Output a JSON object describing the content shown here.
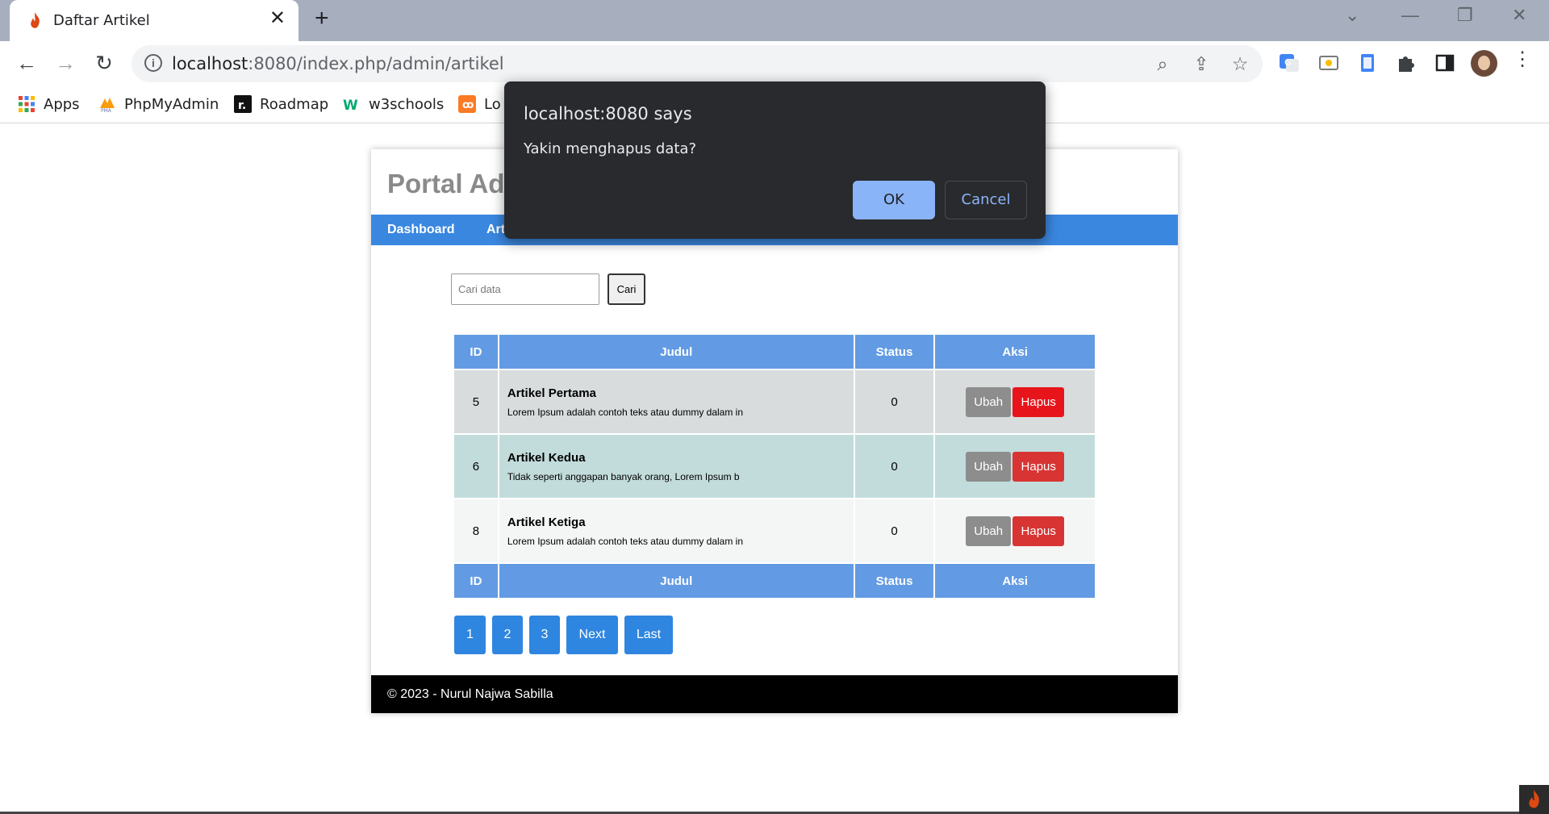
{
  "browser": {
    "tab_title": "Daftar Artikel",
    "tab_close": "✕",
    "new_tab": "+",
    "url_host": "localhost",
    "url_path": ":8080/index.php/admin/artikel",
    "bookmarks": [
      "Apps",
      "PhpMyAdmin",
      "Roadmap",
      "w3schools",
      "Lo"
    ]
  },
  "page": {
    "portal_title": "Portal Admin",
    "nav": [
      "Dashboard",
      "Artikel"
    ],
    "search": {
      "placeholder": "Cari data",
      "button": "Cari"
    },
    "table": {
      "headers": [
        "ID",
        "Judul",
        "Status",
        "Aksi"
      ],
      "rows": [
        {
          "id": "5",
          "title": "Artikel Pertama",
          "excerpt": "Lorem Ipsum adalah contoh teks atau dummy dalam in",
          "status": "0"
        },
        {
          "id": "6",
          "title": "Artikel Kedua",
          "excerpt": "Tidak seperti anggapan banyak orang, Lorem Ipsum b",
          "status": "0"
        },
        {
          "id": "8",
          "title": "Artikel Ketiga",
          "excerpt": "Lorem Ipsum adalah contoh teks atau dummy dalam in",
          "status": "0"
        }
      ],
      "edit_label": "Ubah",
      "delete_label": "Hapus"
    },
    "pagination": [
      "1",
      "2",
      "3",
      "Next",
      "Last"
    ],
    "footer": "© 2023 - Nurul Najwa Sabilla"
  },
  "dialog": {
    "title": "localhost:8080 says",
    "message": "Yakin menghapus data?",
    "ok": "OK",
    "cancel": "Cancel"
  },
  "colors": {
    "accent": "#3a87e0",
    "table_header": "#629be3",
    "delete": "#e8141b",
    "dialog_bg": "#292a2d"
  }
}
